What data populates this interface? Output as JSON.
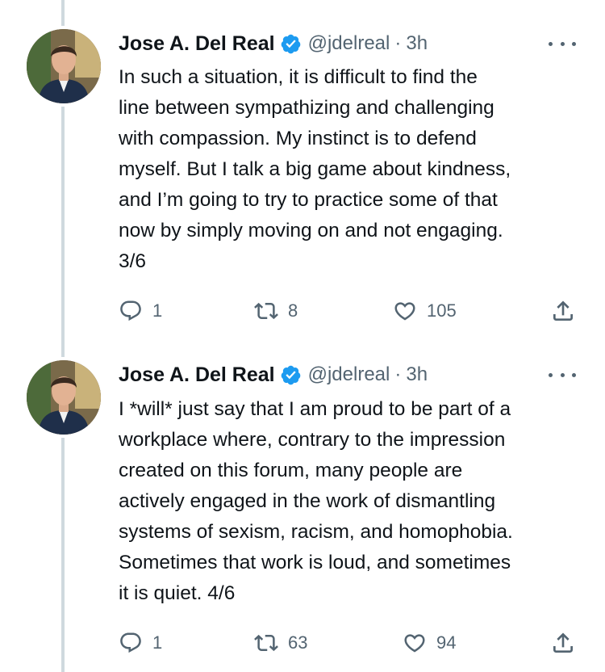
{
  "tweets": [
    {
      "author_name": "Jose A. Del Real",
      "handle": "@jdelreal",
      "separator": "·",
      "time": "3h",
      "lines": [
        "In such a situation, it is difficult to find the",
        "line between sympathizing and challenging",
        "with compassion. My instinct is to defend",
        "myself. But I talk a big game about kindness,",
        "and I’m going to try to practice some of that",
        "now by simply moving on and not engaging.",
        "3/6"
      ],
      "replies": "1",
      "retweets": "8",
      "likes": "105"
    },
    {
      "author_name": "Jose A. Del Real",
      "handle": "@jdelreal",
      "separator": "·",
      "time": "3h",
      "lines": [
        "I *will* just say that I am proud to be part of a",
        "workplace where, contrary to the impression",
        "created on this forum, many people are",
        "actively engaged in the work of dismantling",
        "systems of sexism, racism, and homophobia.",
        "Sometimes that work is loud, and sometimes",
        "it is quiet. 4/6"
      ],
      "replies": "1",
      "retweets": "63",
      "likes": "94"
    }
  ],
  "icons": {
    "verified": "verified-badge-icon",
    "more": "more-options-icon",
    "reply": "reply-icon",
    "retweet": "retweet-icon",
    "like": "heart-icon",
    "share": "share-icon"
  },
  "colors": {
    "verified_blue": "#1d9bf0",
    "secondary_text": "#536471",
    "thread_line": "#cfd9de"
  }
}
